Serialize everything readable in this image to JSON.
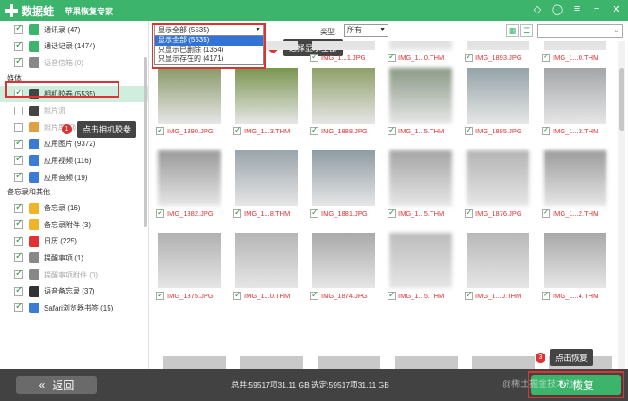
{
  "app": {
    "name": "数据蛙",
    "subtitle": "苹果恢复专家"
  },
  "window_controls": [
    "diamond-icon",
    "chat-icon",
    "menu-icon",
    "minimize-icon",
    "close-icon"
  ],
  "sidebar": {
    "items_top": [
      {
        "label": "通讯录 (47)",
        "checked": true,
        "icon_color": "#3cb46c",
        "disabled": false
      },
      {
        "label": "通话记录 (1474)",
        "checked": true,
        "icon_color": "#3cb46c",
        "disabled": false
      },
      {
        "label": "语音信箱 (0)",
        "checked": true,
        "icon_color": "#888888",
        "disabled": true
      }
    ],
    "section_media": "媒体",
    "items_media": [
      {
        "label": "相机胶卷 (5535)",
        "checked": true,
        "icon_color": "#444444",
        "disabled": false,
        "selected": true
      },
      {
        "label": "照片流",
        "checked": false,
        "icon_color": "#444444",
        "disabled": true
      },
      {
        "label": "照片库 (0)",
        "checked": false,
        "icon_color": "#e0a040",
        "disabled": true
      },
      {
        "label": "应用图片 (9372)",
        "checked": true,
        "icon_color": "#3a7bd5",
        "disabled": false
      },
      {
        "label": "应用视频 (116)",
        "checked": true,
        "icon_color": "#3a7bd5",
        "disabled": false
      },
      {
        "label": "应用音频 (19)",
        "checked": true,
        "icon_color": "#3a7bd5",
        "disabled": false
      }
    ],
    "section_memo": "备忘录和其他",
    "items_memo": [
      {
        "label": "备忘录 (16)",
        "checked": true,
        "icon_color": "#f0b429",
        "disabled": false
      },
      {
        "label": "备忘录附件 (3)",
        "checked": true,
        "icon_color": "#f0b429",
        "disabled": false
      },
      {
        "label": "日历 (225)",
        "checked": true,
        "icon_color": "#e03232",
        "disabled": false
      },
      {
        "label": "提醒事项 (1)",
        "checked": true,
        "icon_color": "#888888",
        "disabled": false
      },
      {
        "label": "提醒事项附件 (0)",
        "checked": true,
        "icon_color": "#888888",
        "disabled": true
      },
      {
        "label": "语音备忘录 (37)",
        "checked": true,
        "icon_color": "#333333",
        "disabled": false
      },
      {
        "label": "Safari浏览器书签 (15)",
        "checked": true,
        "icon_color": "#3a7bd5",
        "disabled": false
      }
    ],
    "tip1": {
      "num": "1",
      "text": "点击相机胶卷"
    }
  },
  "toolbar": {
    "filter_value": "显示全部 (5535)",
    "filter_options": [
      "显示全部 (5535)",
      "只显示已删除 (1364)",
      "只显示存在的 (4171)"
    ],
    "type_label": "类型:",
    "type_value": "所有",
    "tip2": {
      "num": "2",
      "text": "选择显示全部"
    }
  },
  "grid": {
    "rows": [
      [
        "",
        "",
        "IMG_1...1.JPG",
        "IMG_1...0.THM",
        "IMG_1893.JPG",
        "IMG_1...0.THM"
      ],
      [
        "IMG_1890.JPG",
        "IMG_1...3.THM",
        "IMG_1888.JPG",
        "IMG_1...5.THM",
        "IMG_1885.JPG",
        "IMG_1...3.THM"
      ],
      [
        "IMG_1882.JPG",
        "IMG_1...8.THM",
        "IMG_1881.JPG",
        "IMG_1...5.THM",
        "IMG_1876.JPG",
        "IMG_1...2.THM"
      ],
      [
        "IMG_1875.JPG",
        "IMG_1...0.THM",
        "IMG_1874.JPG",
        "IMG_1...5.THM",
        "IMG_1...0.THM",
        "IMG_1...4.THM"
      ]
    ],
    "thumb_colors": [
      [
        "#cfcfcf",
        "#d5d5d5",
        "#d0d0d0",
        "#c8c8c8",
        "#c4c4c4",
        "#c9c9c9"
      ],
      [
        "#8a9a6a",
        "#7a9550",
        "#8ea068",
        "#8b9a86",
        "#94a3a7",
        "#a3a6a8"
      ],
      [
        "#9a9a9a",
        "#9aa4ab",
        "#8f9ca4",
        "#a5a5a5",
        "#b4b4b4",
        "#9c9c9c"
      ],
      [
        "#b0b0b0",
        "#b5b5b5",
        "#a9a9a9",
        "#bcbcbc",
        "#b8b8b8",
        "#a8a8a8"
      ]
    ]
  },
  "footer": {
    "back_label": "返回",
    "status": "总共:59517项31.11 GB 选定:59517项31.11 GB",
    "recover_label": "恢复",
    "tip3": {
      "num": "3",
      "text": "点击恢复"
    },
    "watermark": "@稀土掘金技术社区"
  }
}
